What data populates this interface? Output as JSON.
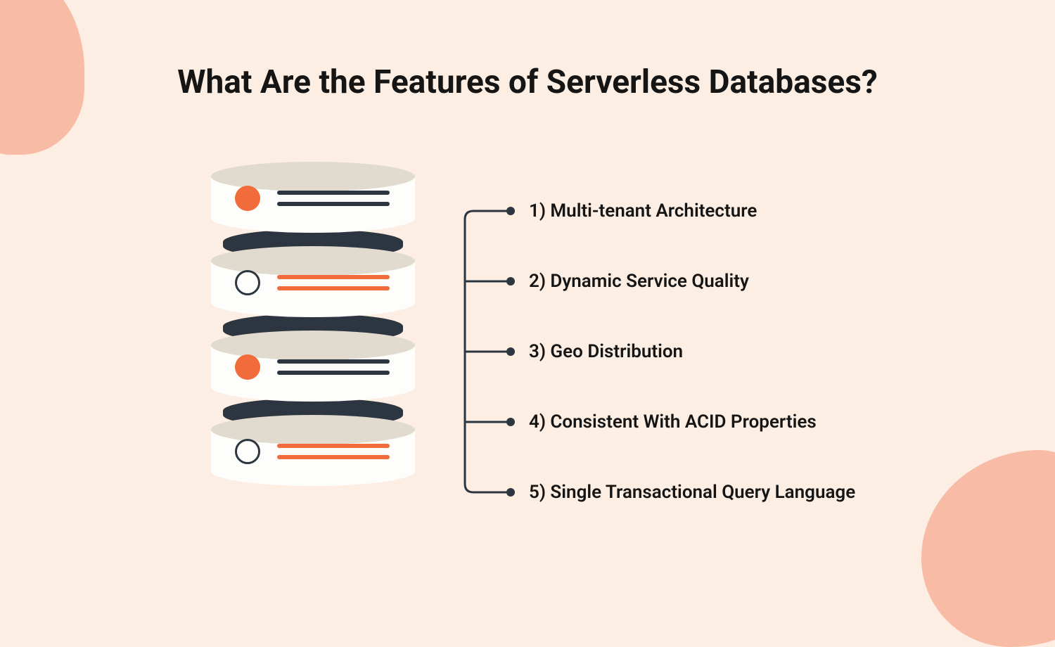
{
  "title": "What Are the Features of Serverless Databases?",
  "features": [
    {
      "label": "1) Multi-tenant Architecture"
    },
    {
      "label": "2) Dynamic Service Quality"
    },
    {
      "label": "3) Geo Distribution"
    },
    {
      "label": "4) Consistent With ACID Properties"
    },
    {
      "label": "5) Single Transactional Query Language"
    }
  ],
  "colors": {
    "background": "#fdeee3",
    "blob": "#f8bca6",
    "dark": "#2d3640",
    "orange": "#f26b3a",
    "diskTop": "#e1dacf",
    "diskSide": "#fdfdfb"
  }
}
